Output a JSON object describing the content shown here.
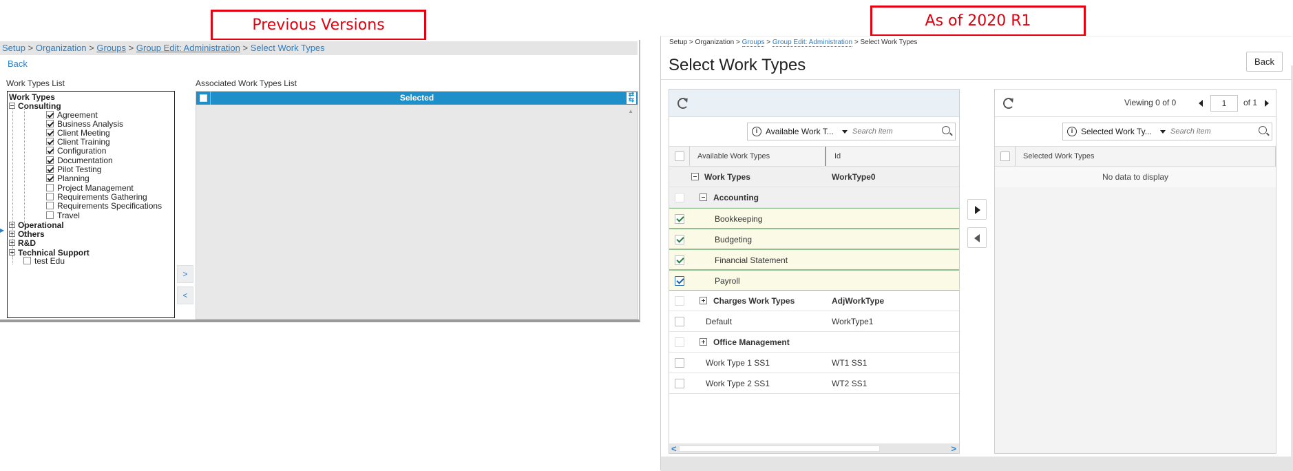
{
  "callouts": {
    "previous": "Previous Versions",
    "current": "As of 2020 R1"
  },
  "old_ui": {
    "breadcrumb": {
      "setup": "Setup",
      "sep": ">",
      "organization": "Organization",
      "groups": "Groups",
      "group_edit": "Group Edit: Administration",
      "current": "Select Work Types"
    },
    "back": "Back",
    "work_types_list_label": "Work Types List",
    "associated_list_label": "Associated Work Types List",
    "tree": {
      "root": "Work Types",
      "consulting": "Consulting",
      "consulting_items": [
        {
          "label": "Agreement",
          "checked": true
        },
        {
          "label": "Business Analysis",
          "checked": true
        },
        {
          "label": "Client Meeting",
          "checked": true
        },
        {
          "label": "Client Training",
          "checked": true
        },
        {
          "label": "Configuration",
          "checked": true
        },
        {
          "label": "Documentation",
          "checked": true
        },
        {
          "label": "Pilot Testing",
          "checked": true
        },
        {
          "label": "Planning",
          "checked": true
        },
        {
          "label": "Project Management",
          "checked": false
        },
        {
          "label": "Requirements Gathering",
          "checked": false
        },
        {
          "label": "Requirements Specifications",
          "checked": false
        },
        {
          "label": "Travel",
          "checked": false
        }
      ],
      "collapsed_groups": [
        "Operational",
        "Others",
        "R&D",
        "Technical Support"
      ],
      "leaf": "test Edu"
    },
    "move_right": ">",
    "move_left": "<",
    "selected_header": "Selected"
  },
  "new_ui": {
    "breadcrumb": {
      "setup": "Setup",
      "sep": ">",
      "organization": "Organization",
      "groups": "Groups",
      "group_edit": "Group Edit: Administration",
      "current": "Select Work Types"
    },
    "title": "Select Work Types",
    "back": "Back",
    "left_panel": {
      "search_scope": "Available Work T...",
      "search_placeholder": "Search item",
      "col_name": "Available Work Types",
      "col_id": "Id",
      "rows": [
        {
          "name": "Work Types",
          "id": "WorkType0",
          "kind": "group",
          "expander": "minus",
          "level": 0
        },
        {
          "name": "Accounting",
          "id": "",
          "kind": "group",
          "expander": "minus",
          "level": 1
        },
        {
          "name": "Bookkeeping",
          "id": "",
          "kind": "selected",
          "level": 2
        },
        {
          "name": "Budgeting",
          "id": "",
          "kind": "selected",
          "level": 2
        },
        {
          "name": "Financial Statement",
          "id": "",
          "kind": "selected",
          "level": 2
        },
        {
          "name": "Payroll",
          "id": "",
          "kind": "selected",
          "level": 2
        },
        {
          "name": "Charges Work Types",
          "id": "AdjWorkType",
          "kind": "collapsed",
          "expander": "plus",
          "level": 1
        },
        {
          "name": "Default",
          "id": "WorkType1",
          "kind": "item",
          "level": 0
        },
        {
          "name": "Office Management",
          "id": "",
          "kind": "collapsed",
          "expander": "plus",
          "level": 1
        },
        {
          "name": "Work Type 1 SS1",
          "id": "WT1 SS1",
          "kind": "item",
          "level": 0
        },
        {
          "name": "Work Type 2 SS1",
          "id": "WT2 SS1",
          "kind": "item",
          "level": 0
        }
      ]
    },
    "right_panel": {
      "viewing_label": "Viewing",
      "viewing_from": "0",
      "viewing_of": "of",
      "viewing_total": "0",
      "page_value": "1",
      "page_of": "of 1",
      "search_scope": "Selected Work Ty...",
      "search_placeholder": "Search item",
      "col_name": "Selected Work Types",
      "empty": "No data to display"
    }
  }
}
